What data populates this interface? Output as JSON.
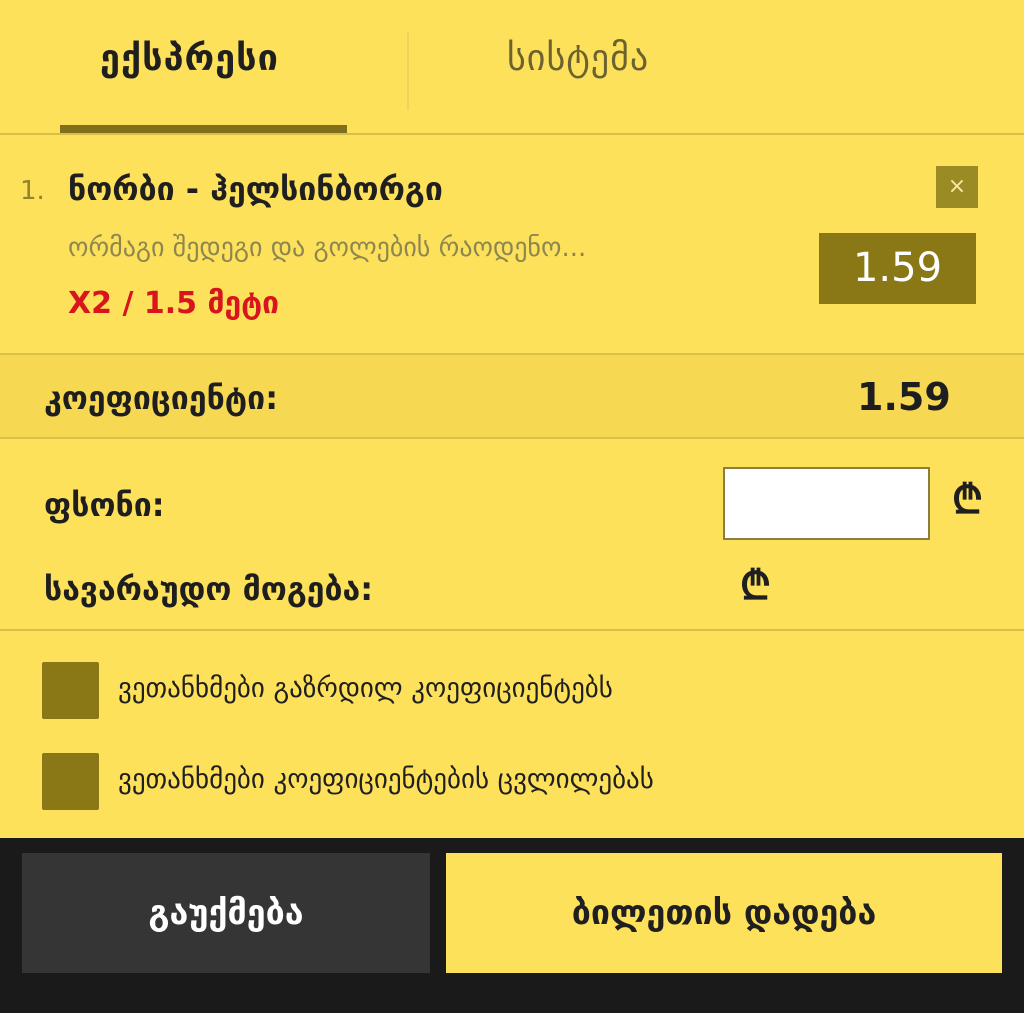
{
  "tabs": {
    "express": "ექსპრესი",
    "system": "სისტემა"
  },
  "bet": {
    "number": "1.",
    "match": "ნორბი - ჰელსინბორგი",
    "market": "ორმაგი შედეგი და გოლების რაოდენო...",
    "pick": "X2 / 1.5 მეტი",
    "odds": "1.59",
    "remove_icon": "×"
  },
  "coefficient": {
    "label": "კოეფიციენტი:",
    "value": "1.59"
  },
  "stake": {
    "label": "ფსონი:",
    "value": "",
    "currency": "₾"
  },
  "potential_win": {
    "label": "სავარაუდო მოგება:",
    "currency": "₾"
  },
  "options": [
    {
      "label": "ვეთანხმები გაზრდილ კოეფიციენტებს"
    },
    {
      "label": "ვეთანხმები კოეფიციენტების ცვლილებას"
    }
  ],
  "buttons": {
    "cancel": "გაუქმება",
    "place": "ბილეთის დადება"
  },
  "colors": {
    "background": "#fde15a",
    "accent": "#8a7716",
    "pick_red": "#d8141d",
    "footer": "#1a1a1a"
  }
}
